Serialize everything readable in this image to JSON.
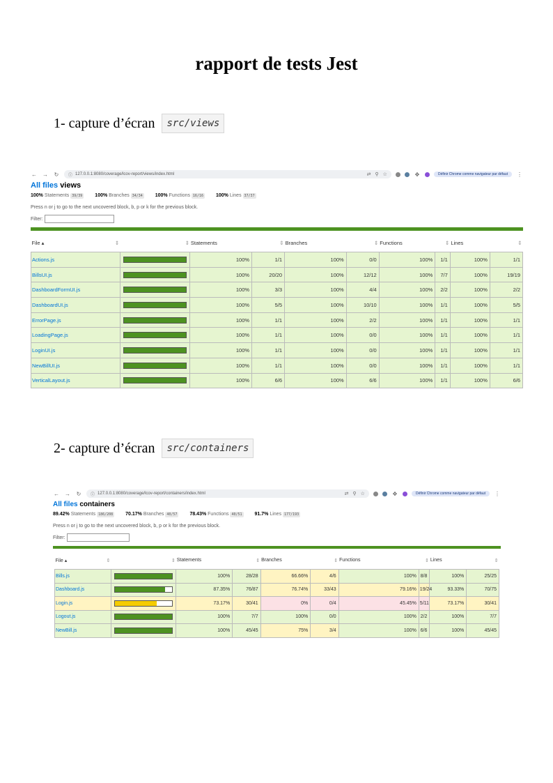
{
  "title": "rapport de tests Jest",
  "sections": [
    {
      "heading": "1- capture d’écran",
      "code": "src/views",
      "url": "127.0.0.1:8080/coverage/lcov-report/views/index.html",
      "default_browser_label": "Définir Chrome comme navigateur par défaut",
      "report_link": "All files",
      "report_dir": "views",
      "summary": [
        {
          "pct": "100%",
          "label": "Statements",
          "fraction": "39/39"
        },
        {
          "pct": "100%",
          "label": "Branches",
          "fraction": "34/34"
        },
        {
          "pct": "100%",
          "label": "Functions",
          "fraction": "16/16"
        },
        {
          "pct": "100%",
          "label": "Lines",
          "fraction": "37/37"
        }
      ],
      "hint": "Press n or j to go to the next uncovered block, b, p or k for the previous block.",
      "filter_label": "Filter:",
      "headers": [
        "File",
        "Statements",
        "Branches",
        "Functions",
        "Lines"
      ],
      "rows": [
        {
          "file": "Actions.js",
          "coverage": 1.0,
          "level": "high",
          "cells": [
            "100%",
            "1/1",
            "100%",
            "0/0",
            "100%",
            "1/1",
            "100%",
            "1/1"
          ],
          "levels": [
            "high",
            "high",
            "high",
            "high"
          ]
        },
        {
          "file": "BillsUI.js",
          "coverage": 1.0,
          "level": "high",
          "cells": [
            "100%",
            "20/20",
            "100%",
            "12/12",
            "100%",
            "7/7",
            "100%",
            "19/19"
          ],
          "levels": [
            "high",
            "high",
            "high",
            "high"
          ]
        },
        {
          "file": "DashboardFormUI.js",
          "coverage": 1.0,
          "level": "high",
          "cells": [
            "100%",
            "3/3",
            "100%",
            "4/4",
            "100%",
            "2/2",
            "100%",
            "2/2"
          ],
          "levels": [
            "high",
            "high",
            "high",
            "high"
          ]
        },
        {
          "file": "DashboardUI.js",
          "coverage": 1.0,
          "level": "high",
          "cells": [
            "100%",
            "5/5",
            "100%",
            "10/10",
            "100%",
            "1/1",
            "100%",
            "5/5"
          ],
          "levels": [
            "high",
            "high",
            "high",
            "high"
          ]
        },
        {
          "file": "ErrorPage.js",
          "coverage": 1.0,
          "level": "high",
          "cells": [
            "100%",
            "1/1",
            "100%",
            "2/2",
            "100%",
            "1/1",
            "100%",
            "1/1"
          ],
          "levels": [
            "high",
            "high",
            "high",
            "high"
          ]
        },
        {
          "file": "LoadingPage.js",
          "coverage": 1.0,
          "level": "high",
          "cells": [
            "100%",
            "1/1",
            "100%",
            "0/0",
            "100%",
            "1/1",
            "100%",
            "1/1"
          ],
          "levels": [
            "high",
            "high",
            "high",
            "high"
          ]
        },
        {
          "file": "LoginUI.js",
          "coverage": 1.0,
          "level": "high",
          "cells": [
            "100%",
            "1/1",
            "100%",
            "0/0",
            "100%",
            "1/1",
            "100%",
            "1/1"
          ],
          "levels": [
            "high",
            "high",
            "high",
            "high"
          ]
        },
        {
          "file": "NewBillUI.js",
          "coverage": 1.0,
          "level": "high",
          "cells": [
            "100%",
            "1/1",
            "100%",
            "0/0",
            "100%",
            "1/1",
            "100%",
            "1/1"
          ],
          "levels": [
            "high",
            "high",
            "high",
            "high"
          ]
        },
        {
          "file": "VerticalLayout.js",
          "coverage": 1.0,
          "level": "high",
          "cells": [
            "100%",
            "6/6",
            "100%",
            "6/6",
            "100%",
            "1/1",
            "100%",
            "6/6"
          ],
          "levels": [
            "high",
            "high",
            "high",
            "high"
          ]
        }
      ]
    },
    {
      "heading": "2- capture d’écran",
      "code": "src/containers",
      "url": "127.0.0.1:8080/coverage/lcov-report/containers/index.html",
      "default_browser_label": "Définir Chrome comme navigateur par défaut",
      "report_link": "All files",
      "report_dir": "containers",
      "summary": [
        {
          "pct": "89.42%",
          "label": "Statements",
          "fraction": "186/208"
        },
        {
          "pct": "70.17%",
          "label": "Branches",
          "fraction": "40/57"
        },
        {
          "pct": "78.43%",
          "label": "Functions",
          "fraction": "40/51"
        },
        {
          "pct": "91.7%",
          "label": "Lines",
          "fraction": "177/193"
        }
      ],
      "hint": "Press n or j to go to the next uncovered block, b, p or k for the previous block.",
      "filter_label": "Filter:",
      "headers": [
        "File",
        "Statements",
        "Branches",
        "Functions",
        "Lines"
      ],
      "rows": [
        {
          "file": "Bills.js",
          "coverage": 1.0,
          "level": "high",
          "cells": [
            "100%",
            "28/28",
            "66.66%",
            "4/6",
            "100%",
            "8/8",
            "100%",
            "25/25"
          ],
          "levels": [
            "high",
            "med",
            "high",
            "high"
          ]
        },
        {
          "file": "Dashboard.js",
          "coverage": 0.8735,
          "level": "high",
          "cells": [
            "87.35%",
            "76/87",
            "76.74%",
            "33/43",
            "79.16%",
            "19/24",
            "93.33%",
            "70/75"
          ],
          "levels": [
            "high",
            "med",
            "med",
            "high"
          ]
        },
        {
          "file": "Login.js",
          "coverage": 0.7317,
          "level": "med",
          "cells": [
            "73.17%",
            "30/41",
            "0%",
            "0/4",
            "45.45%",
            "5/11",
            "73.17%",
            "30/41"
          ],
          "levels": [
            "med",
            "low",
            "low",
            "med"
          ]
        },
        {
          "file": "Logout.js",
          "coverage": 1.0,
          "level": "high",
          "cells": [
            "100%",
            "7/7",
            "100%",
            "0/0",
            "100%",
            "2/2",
            "100%",
            "7/7"
          ],
          "levels": [
            "high",
            "high",
            "high",
            "high"
          ]
        },
        {
          "file": "NewBill.js",
          "coverage": 1.0,
          "level": "high",
          "cells": [
            "100%",
            "45/45",
            "75%",
            "3/4",
            "100%",
            "6/6",
            "100%",
            "45/45"
          ],
          "levels": [
            "high",
            "med",
            "high",
            "high"
          ]
        }
      ]
    }
  ],
  "colors": {
    "bar_high": "#4d9221",
    "bar_med": "#f5cc00",
    "link": "#0074D9"
  }
}
